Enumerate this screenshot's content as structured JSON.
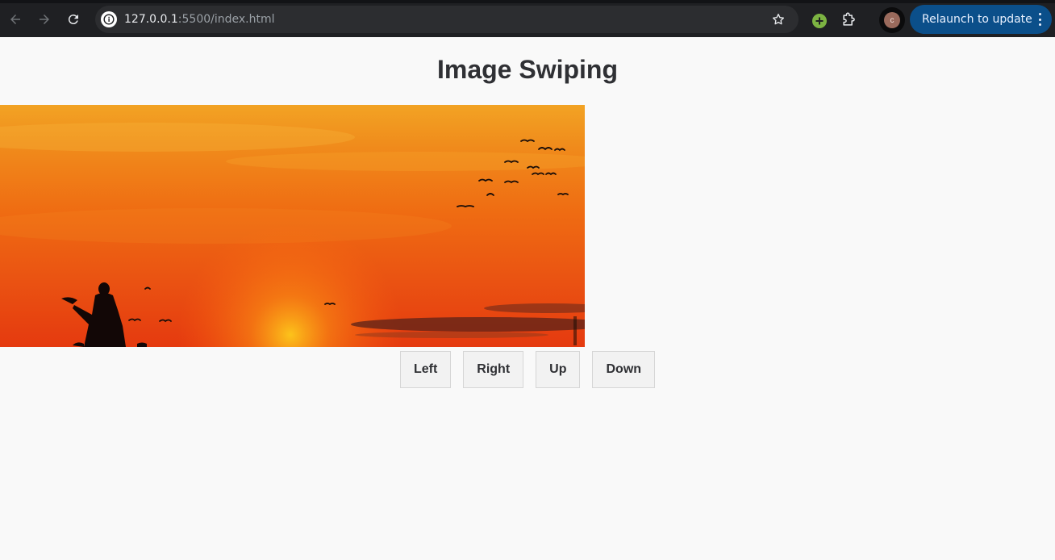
{
  "browser": {
    "url_host": "127.0.0.1",
    "url_rest": ":5500/index.html",
    "avatar_letter": "c",
    "relaunch_label": "Relaunch to update",
    "icons": [
      "back-arrow-icon",
      "forward-arrow-icon",
      "reload-icon",
      "site-info-icon",
      "bookmark-star-icon",
      "extension-icon",
      "puzzle-icon",
      "kebab-menu-icon"
    ]
  },
  "page": {
    "title": "Image Swiping",
    "image": {
      "description": "sunset silhouette with birds"
    },
    "buttons": {
      "left": "Left",
      "right": "Right",
      "up": "Up",
      "down": "Down"
    }
  },
  "colors": {
    "chrome_bg": "#1f2023",
    "relaunch_bg": "#0b4f8a",
    "page_bg": "#f9f9f9",
    "title_color": "#2f3034"
  }
}
